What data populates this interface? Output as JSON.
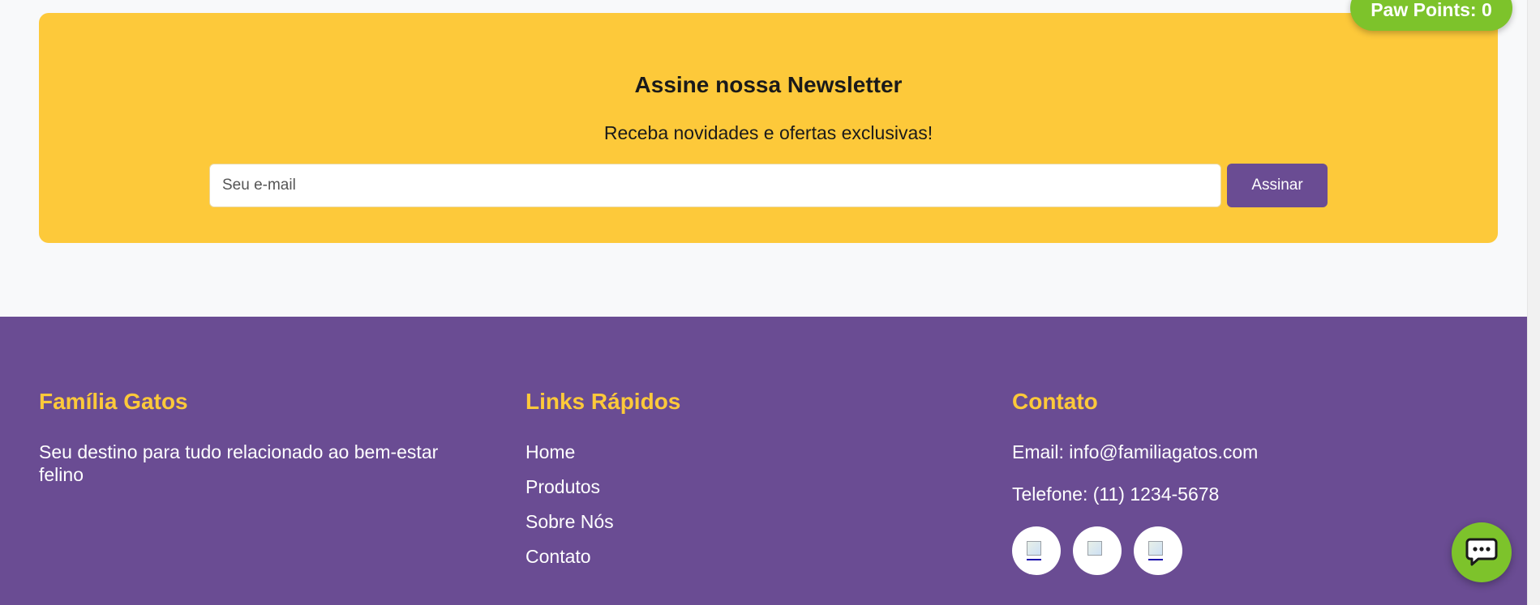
{
  "newsletter": {
    "title": "Assine nossa Newsletter",
    "subtitle": "Receba novidades e ofertas exclusivas!",
    "email_placeholder": "Seu e-mail",
    "email_value": "",
    "subscribe_label": "Assinar",
    "background_color": "#fdc93a"
  },
  "footer": {
    "background_color": "#6a4c93",
    "heading_color": "#fdc93a",
    "about": {
      "heading": "Família Gatos",
      "description": "Seu destino para tudo relacionado ao bem-estar felino"
    },
    "quick_links": {
      "heading": "Links Rápidos",
      "items": [
        {
          "label": "Home"
        },
        {
          "label": "Produtos"
        },
        {
          "label": "Sobre Nós"
        },
        {
          "label": "Contato"
        }
      ]
    },
    "contact": {
      "heading": "Contato",
      "email": "Email: info@familiagatos.com",
      "phone": "Telefone: (11) 1234-5678",
      "social_icons": [
        "broken-image-icon",
        "broken-image-icon",
        "broken-image-icon"
      ]
    }
  },
  "paw_points": {
    "label": "Paw Points: 0",
    "color": "#7dc32b"
  },
  "chat": {
    "icon": "chat-bubble-icon",
    "color": "#7dc32b"
  }
}
